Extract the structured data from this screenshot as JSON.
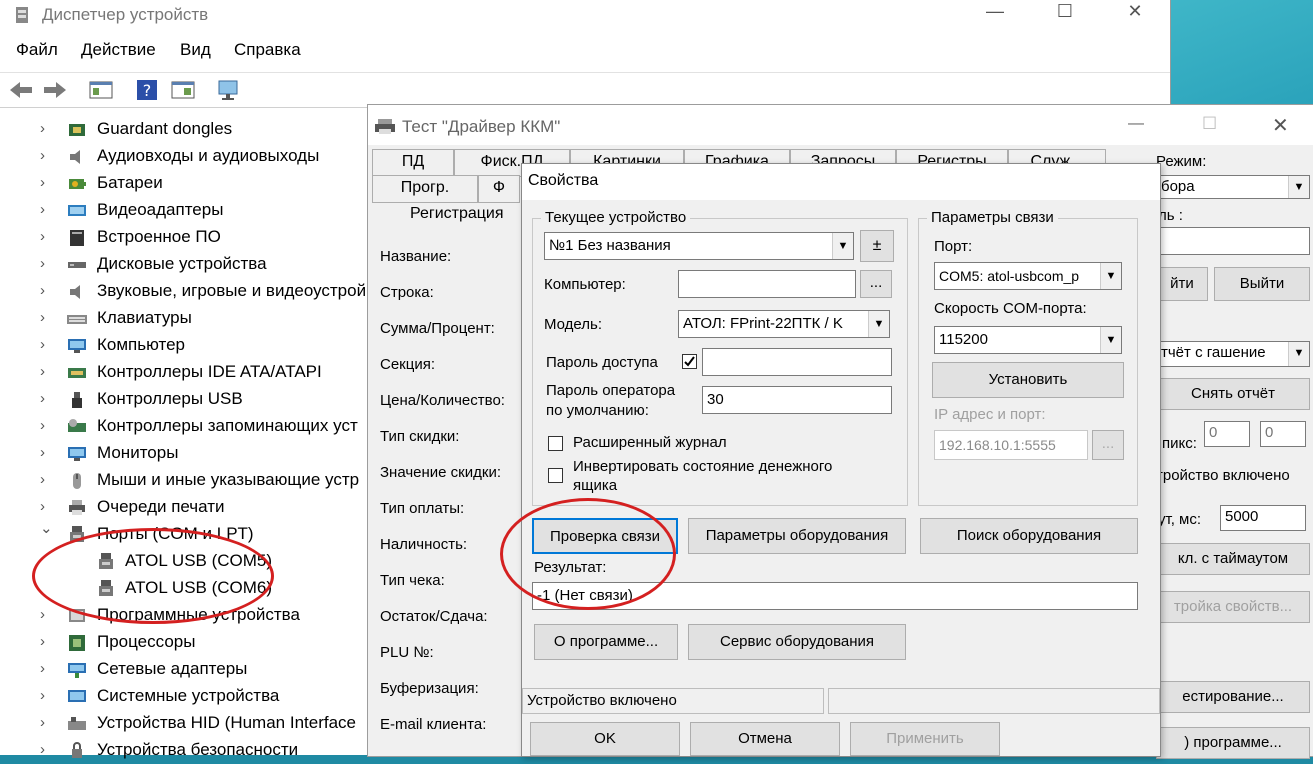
{
  "device_manager": {
    "title": "Диспетчер устройств",
    "window_buttons": {
      "minimize": "—",
      "maximize": "☐",
      "close": "✕"
    },
    "menu": [
      "Файл",
      "Действие",
      "Вид",
      "Справка"
    ],
    "tree_items": [
      {
        "label": "Guardant dongles",
        "icon": "dongle-icon"
      },
      {
        "label": "Аудиовходы и аудиовыходы",
        "icon": "speaker-icon"
      },
      {
        "label": "Батареи",
        "icon": "battery-icon"
      },
      {
        "label": "Видеоадаптеры",
        "icon": "display-adapter-icon"
      },
      {
        "label": "Встроенное ПО",
        "icon": "firmware-icon"
      },
      {
        "label": "Дисковые устройства",
        "icon": "disk-icon"
      },
      {
        "label": "Звуковые, игровые и видеоустрой",
        "icon": "speaker-icon"
      },
      {
        "label": "Клавиатуры",
        "icon": "keyboard-icon"
      },
      {
        "label": "Компьютер",
        "icon": "monitor-icon"
      },
      {
        "label": "Контроллеры IDE ATA/ATAPI",
        "icon": "ide-controller-icon"
      },
      {
        "label": "Контроллеры USB",
        "icon": "usb-icon"
      },
      {
        "label": "Контроллеры запоминающих уст",
        "icon": "storage-controller-icon"
      },
      {
        "label": "Мониторы",
        "icon": "monitor-icon"
      },
      {
        "label": "Мыши и иные указывающие устр",
        "icon": "mouse-icon"
      },
      {
        "label": "Очереди печати",
        "icon": "printer-icon"
      },
      {
        "label": "Порты (COM и LPT)",
        "icon": "port-icon",
        "expanded": true
      },
      {
        "label": "ATOL USB (COM5)",
        "icon": "port-icon",
        "child": true
      },
      {
        "label": "ATOL USB (COM6)",
        "icon": "port-icon",
        "child": true
      },
      {
        "label": "Программные устройства",
        "icon": "software-device-icon"
      },
      {
        "label": "Процессоры",
        "icon": "cpu-icon"
      },
      {
        "label": "Сетевые адаптеры",
        "icon": "network-adapter-icon"
      },
      {
        "label": "Системные устройства",
        "icon": "system-device-icon"
      },
      {
        "label": "Устройства HID (Human Interface",
        "icon": "hid-icon"
      },
      {
        "label": "Устройства безопасности",
        "icon": "security-device-icon"
      }
    ]
  },
  "driver_window": {
    "title": "Тест \"Драйвер ККМ\"",
    "tabs_row1": [
      "ПД",
      "Фиск.ПД",
      "Картинки",
      "Графика",
      "Запросы",
      "Регистры",
      "Служ..."
    ],
    "tabs_row2": [
      "Прогр.",
      "Ф"
    ],
    "subtab": "Регистрация",
    "labels": [
      "Название:",
      "Строка:",
      "Сумма/Процент:",
      "Секция:",
      "Цена/Количество:",
      "Тип скидки:",
      "Значение скидки:",
      "Тип оплаты:",
      "Наличность:",
      "Тип чека:",
      "Остаток/Сдача:",
      "PLU №:",
      "Буферизация:",
      "E-mail клиента:"
    ],
    "right": {
      "mode_label": "Режим:",
      "mode_value": "бора",
      "password_label": "ль :",
      "enter_button": "йти",
      "exit_button": "Выйти",
      "report_value": "тчёт с гашение",
      "remove_report_button": "Снять отчёт",
      "pixels_label": "пикс:",
      "pixels_val1": "0",
      "pixels_val2": "0",
      "device_on": "тройство включено",
      "timeout_label": "ут, мс:",
      "timeout_value": "5000",
      "timeout_button": "кл. с таймаутом",
      "props_button": "тройка свойств...",
      "testing_button": "естирование...",
      "about_button": ") программе..."
    }
  },
  "properties": {
    "title": "Свойства",
    "current_device": {
      "group": "Текущее устройство",
      "device_value": "№1 Без названия",
      "plusminus": "±",
      "computer_label": "Компьютер:",
      "computer_value": "",
      "browse": "...",
      "model_label": "Модель:",
      "model_value": "АТОЛ: FPrint-22ПТК / K",
      "access_password_label": "Пароль доступа",
      "access_password_value": "",
      "operator_password_label_1": "Пароль оператора",
      "operator_password_label_2": "по умолчанию:",
      "operator_password_value": "30",
      "extended_log_label": "Расширенный журнал",
      "invert_label_1": "Инвертировать состояние денежного",
      "invert_label_2": "ящика"
    },
    "connection": {
      "group": "Параметры связи",
      "port_label": "Порт:",
      "port_value": "COM5: atol-usbcom_p",
      "speed_label": "Скорость COM-порта:",
      "speed_value": "115200",
      "set_button": "Установить",
      "ip_label": "IP адрес и порт:",
      "ip_value": "192.168.10.1:5555",
      "ip_browse": "..."
    },
    "buttons": {
      "check": "Проверка связи",
      "params": "Параметры оборудования",
      "search": "Поиск оборудования",
      "about": "О программе...",
      "service": "Сервис оборудования",
      "ok": "OK",
      "cancel": "Отмена",
      "apply": "Применить"
    },
    "result_label": "Результат:",
    "result_value": "-1 (Нет связи)",
    "status": "Устройство включено"
  }
}
